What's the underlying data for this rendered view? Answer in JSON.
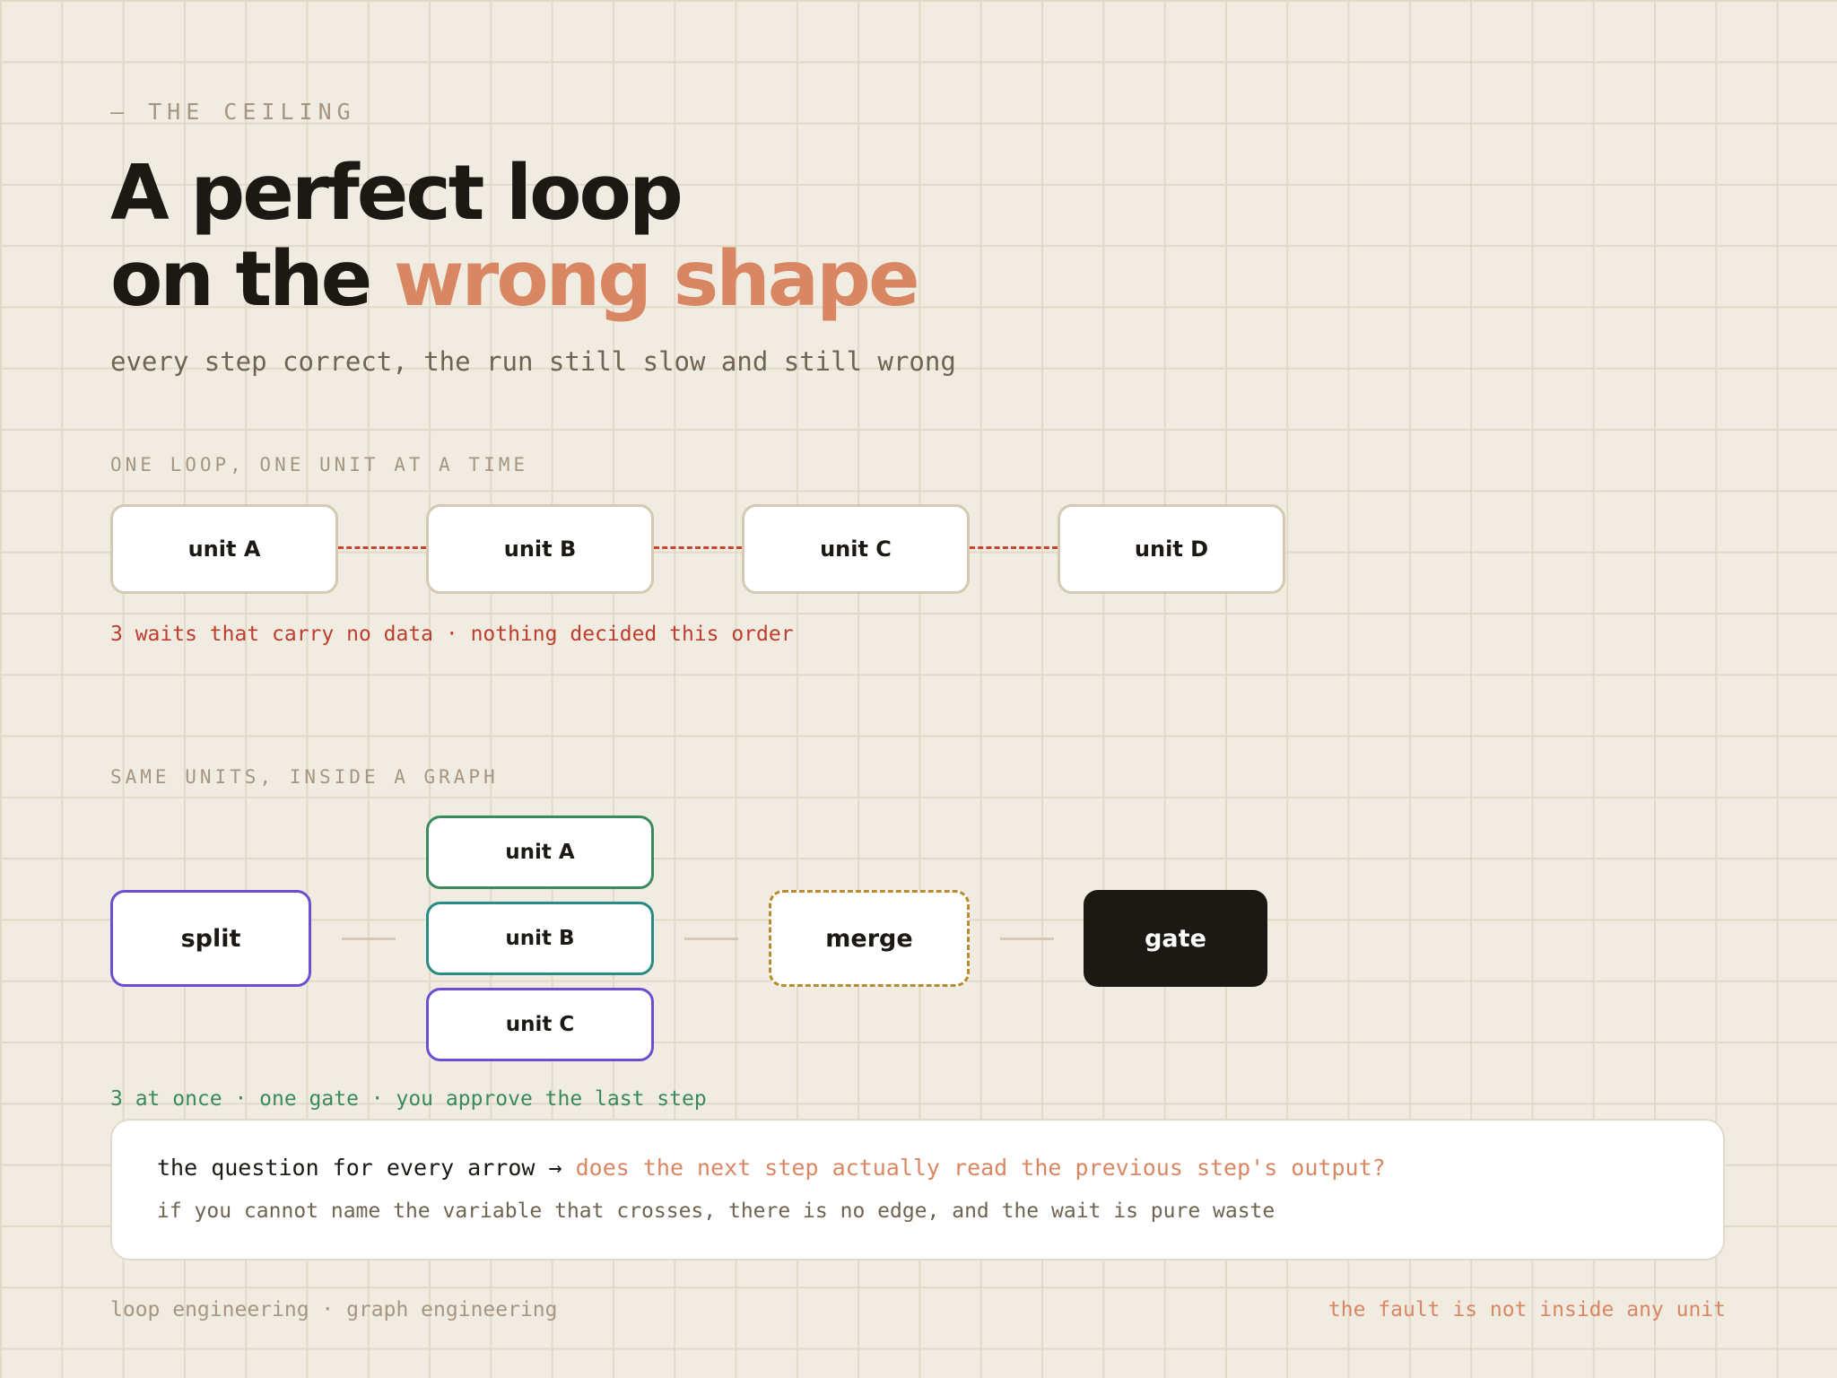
{
  "header": {
    "eyebrow": "— THE CEILING",
    "title_line1": "A perfect loop",
    "title_line2_plain": "on the ",
    "title_line2_accent": "wrong shape",
    "subtitle": "every step correct, the run still slow and still wrong"
  },
  "sequential": {
    "label": "ONE LOOP, ONE UNIT AT A TIME",
    "units": [
      "unit A",
      "unit B",
      "unit C",
      "unit D"
    ],
    "note": "3 waits that carry no data · nothing decided this order"
  },
  "graph": {
    "label": "SAME UNITS, INSIDE A GRAPH",
    "split": "split",
    "units": [
      "unit A",
      "unit B",
      "unit C"
    ],
    "merge": "merge",
    "gate": "gate",
    "note": "3 at once · one gate · you approve the last step"
  },
  "callout": {
    "prefix": "the question for every arrow → ",
    "question": "does the next step actually read the previous step's output?",
    "detail": "if you cannot name the variable that crosses, there is no edge, and the wait is pure waste"
  },
  "footer": {
    "left": "loop engineering · graph engineering",
    "right": "the fault is not inside any unit"
  },
  "colors": {
    "background": "#f1ece2",
    "accent": "#d98763",
    "wait_red": "#bf3d2c",
    "green": "#3a8a5e",
    "teal": "#2a8a86",
    "purple": "#6c4fd1",
    "merge_gold": "#b98a2e",
    "gate_dark": "#1c1914"
  }
}
